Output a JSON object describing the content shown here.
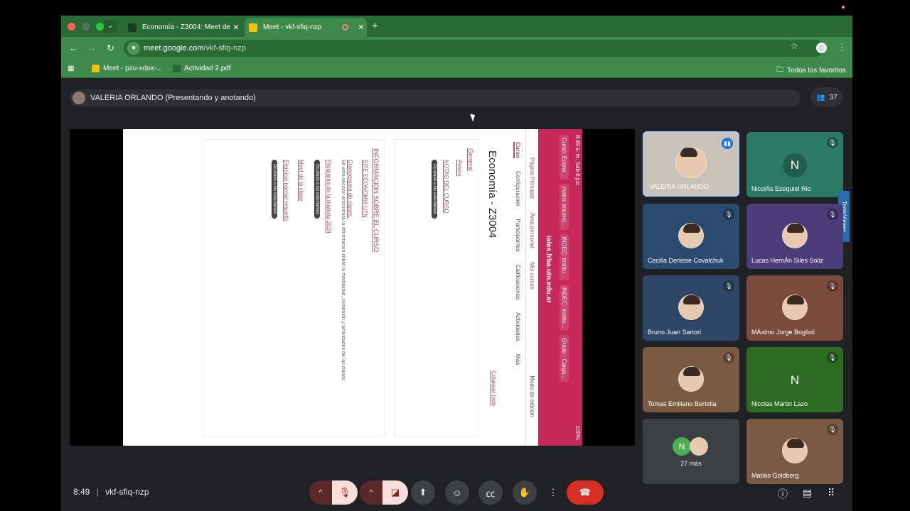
{
  "browser": {
    "tabs": [
      {
        "title": "Economía - Z3004: Meet de l",
        "icon": "moodle-icon",
        "active": false
      },
      {
        "title": "Meet - vkf-sfiq-nzp",
        "icon": "meet-icon",
        "active": true
      }
    ],
    "url_host": "meet.google.com",
    "url_path": "/vkf-sfiq-nzp",
    "bookmarks": [
      {
        "label": "Meet - pzu-xdox-...",
        "icon": "meet-icon"
      },
      {
        "label": "Actividad 2.pdf",
        "icon": "pdf-icon"
      }
    ],
    "all_bookmarks": "Todos los favoritos",
    "theme_color": "#3e8a4a"
  },
  "meet": {
    "presenter_label": "VALERIA ORLANDO (Presentando y anotando)",
    "participant_count": "37",
    "time": "8:49",
    "meeting_code": "vkf-sfiq-nzp",
    "teamviewer": "TeamViewer",
    "participants": [
      {
        "name": "VALERIA ORLANDO",
        "type": "video",
        "speaking": true
      },
      {
        "name": "NicolÁs Ezequiel Rio",
        "type": "letter",
        "letter": "N",
        "bg": "#2c7a63"
      },
      {
        "name": "Cecilia Denisse Covalchuk",
        "type": "photo",
        "bg": "#2b4a70"
      },
      {
        "name": "Lucas HernÁn Siles Soliz",
        "type": "photo",
        "bg": "#4a3d7a"
      },
      {
        "name": "Bruno Juan Sartori",
        "type": "photo",
        "bg": "#2f4766"
      },
      {
        "name": "MÁximo Jorge Boglioli",
        "type": "photo",
        "bg": "#7a4b3d"
      },
      {
        "name": "Tomas Emiliano Bertella",
        "type": "photo",
        "bg": "#7a5a40"
      },
      {
        "name": "Nicolas Martin Lazo",
        "type": "letter",
        "letter": "N",
        "bg": "#2d6a24"
      },
      {
        "name": "27 más",
        "type": "more"
      },
      {
        "name": "Matías Goldberg",
        "type": "photo",
        "bg": "#7a5a45"
      }
    ]
  },
  "shared_screen": {
    "status_time": "8:49 a. m.  Sáb 6 jun",
    "battery": "100%",
    "tabs": [
      "Curso: Econo...",
      "matriz insumo...",
      "INDEC: Institu...",
      "INDEC: Institu...",
      "Grado - Carga..."
    ],
    "address": "iales.frba.utn.edu.ar",
    "nav": [
      "Página Principal",
      "Área personal",
      "Mis cursos"
    ],
    "course_tabs": [
      "Curso",
      "Configuración",
      "Participantes",
      "Calificaciones",
      "Actividades",
      "Más"
    ],
    "course_title": "Economía - Z3004",
    "edit_mode": "Modo de edición",
    "collapse": "Colapsar todo",
    "section1": {
      "title": "General",
      "items": [
        {
          "label": "Avisos",
          "hidden": ""
        },
        {
          "label": "NOTAS DEL CURSO",
          "hidden": "Ocultado a los estudiantes"
        }
      ]
    },
    "section2": {
      "title": "INFORMACION SOBRE EL CURSO",
      "items": [
        {
          "label": "SITE ECONOMIA UTN",
          "hidden": ""
        },
        {
          "label": "Cronograma de clases.",
          "hidden": "",
          "desc": "En esta sección encontrará la información sobre la modalidad, contenido y actividades de las clases."
        },
        {
          "label": "Programa de la materia 2024",
          "hidden": "Ocultado a los estudiantes"
        },
        {
          "label": "Meet de la clase",
          "hidden": ""
        },
        {
          "label": "Ejercicio parcial resuelto",
          "hidden": "Ocultado a los estudiantes"
        }
      ]
    }
  }
}
